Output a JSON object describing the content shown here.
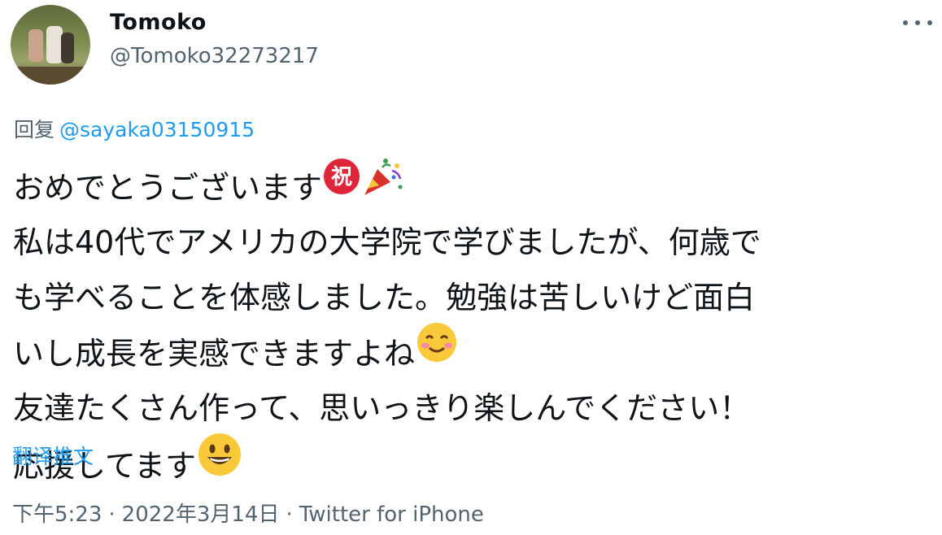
{
  "author": {
    "name": "Tomoko",
    "handle": "@Tomoko32273217"
  },
  "reply": {
    "label": "回复",
    "mention": "@sayaka03150915"
  },
  "tweet": {
    "line1": "おめでとうございます",
    "line2": "私は40代でアメリカの大学院で学びましたが、何歳で",
    "line3": "も学べることを体感しました。勉強は苦しいけど面白",
    "line4": "いし成長を実感できますよね",
    "line5": "友達たくさん作って、思いっきり楽しんでください！",
    "line6": "応援してます",
    "emoji_congrats": "祝"
  },
  "translate_label": "翻译推文",
  "meta": {
    "time": "下午5:23",
    "date": "2022年3月14日",
    "separator": "·",
    "source": "Twitter for iPhone"
  },
  "icons": [
    "avatar",
    "more-icon",
    "congratulations-emoji",
    "party-popper-emoji",
    "smiling-blush-emoji",
    "grinning-face-emoji"
  ],
  "colors": {
    "link": "#1d9bf0",
    "secondary_text": "#536471",
    "text": "#0f1419"
  }
}
